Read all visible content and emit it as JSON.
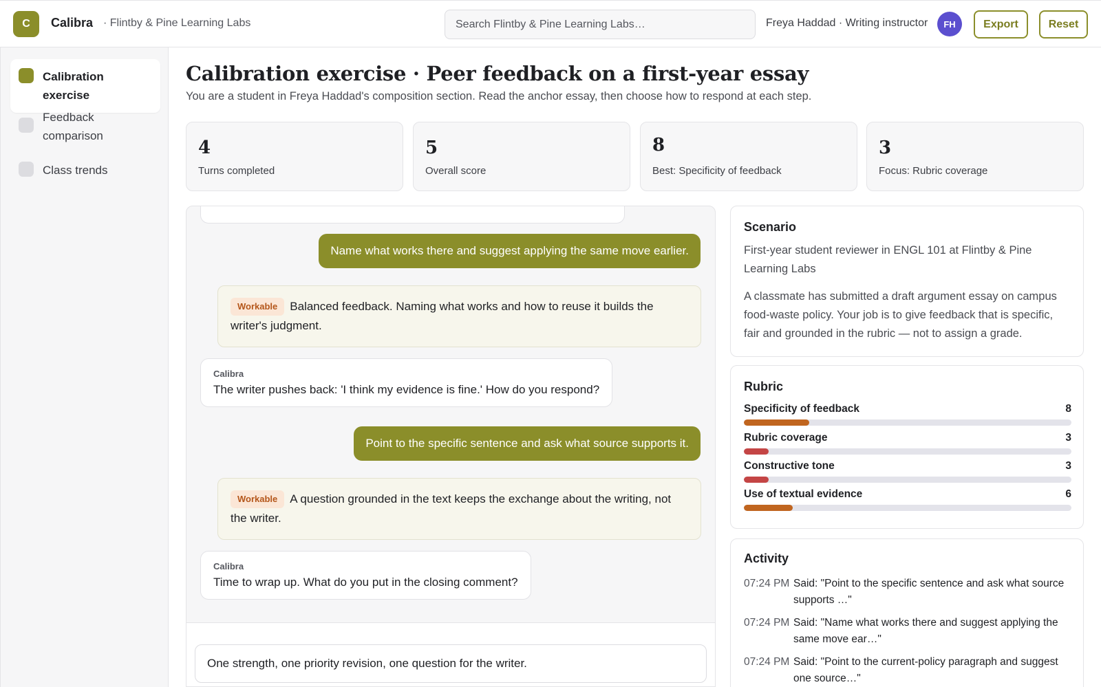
{
  "app": {
    "logo_letter": "C",
    "name": "Calibra",
    "org": "· Flintby & Pine Learning Labs",
    "search_placeholder": "Search Flintby & Pine Learning Labs…",
    "user": "Freya Haddad · Writing instructor",
    "avatar_initials": "FH",
    "export_label": "Export",
    "reset_label": "Reset"
  },
  "sidebar": {
    "items": [
      {
        "label": "Calibration exercise",
        "active": true
      },
      {
        "label": "Feedback comparison",
        "active": false
      },
      {
        "label": "Class trends",
        "active": false
      }
    ]
  },
  "page": {
    "title": "Calibration exercise · Peer feedback on a first-year essay",
    "subtitle": "You are a student in Freya Haddad's composition section. Read the anchor essay, then choose how to respond at each step."
  },
  "stats": [
    {
      "value": "4",
      "label": "Turns completed"
    },
    {
      "value": "5",
      "label": "Overall score"
    },
    {
      "value": "8",
      "label": "Best: Specificity of feedback"
    },
    {
      "value": "3",
      "label": "Focus: Rubric coverage"
    }
  ],
  "chat": {
    "bot_name": "Calibra",
    "user_msg_1": "Name what works there and suggest applying the same move earlier.",
    "feedback_1_tag": "Workable",
    "feedback_1_text": "Balanced feedback. Naming what works and how to reuse it builds the writer's judgment.",
    "bot_msg_1": "The writer pushes back: 'I think my evidence is fine.' How do you respond?",
    "user_msg_2": "Point to the specific sentence and ask what source supports it.",
    "feedback_2_tag": "Workable",
    "feedback_2_text": "A question grounded in the text keeps the exchange about the writing, not the writer.",
    "bot_msg_2": "Time to wrap up. What do you put in the closing comment?",
    "composer_value": "One strength, one priority revision, one question for the writer."
  },
  "scenario": {
    "title": "Scenario",
    "p1": "First-year student reviewer in ENGL 101 at Flintby & Pine Learning Labs",
    "p2": "A classmate has submitted a draft argument essay on campus food-waste policy. Your job is to give feedback that is specific, fair and grounded in the rubric — not to assign a grade."
  },
  "rubric": {
    "title": "Rubric",
    "max_score": 40,
    "items": [
      {
        "name": "Specificity of feedback",
        "score": 8,
        "color": "#c0651f"
      },
      {
        "name": "Rubric coverage",
        "score": 3,
        "color": "#c44545"
      },
      {
        "name": "Constructive tone",
        "score": 3,
        "color": "#c44545"
      },
      {
        "name": "Use of textual evidence",
        "score": 6,
        "color": "#c0651f"
      }
    ]
  },
  "activity": {
    "title": "Activity",
    "items": [
      {
        "time": "07:24 PM",
        "text": "Said: \"Point to the specific sentence and ask what source supports …\""
      },
      {
        "time": "07:24 PM",
        "text": "Said: \"Name what works there and suggest applying the same move ear…\""
      },
      {
        "time": "07:24 PM",
        "text": "Said: \"Point to the current-policy paragraph and suggest one source…\""
      }
    ]
  }
}
